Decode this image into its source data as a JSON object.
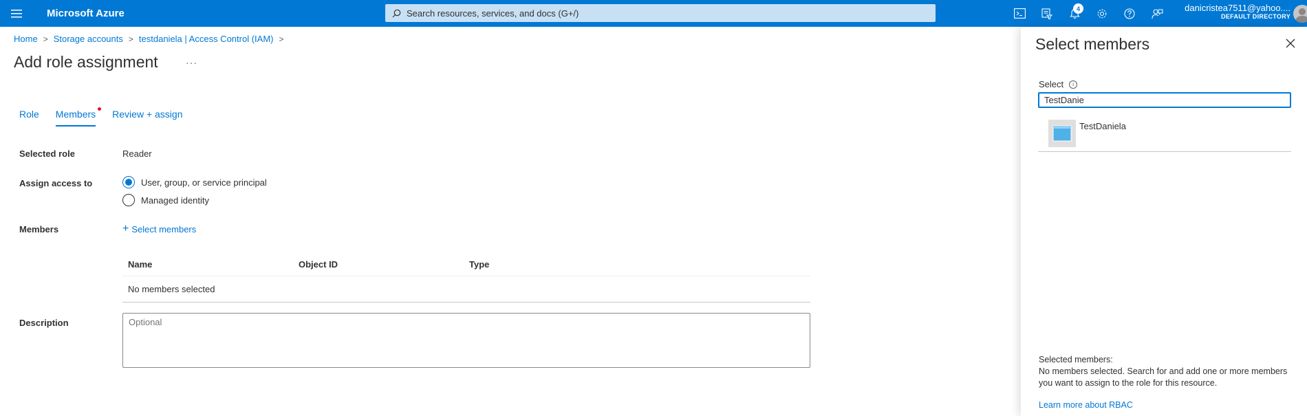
{
  "topbar": {
    "brand": "Microsoft Azure",
    "search_placeholder": "Search resources, services, and docs (G+/)",
    "notification_count": "4",
    "account_name": "danicristea7511@yahoo....",
    "account_directory": "DEFAULT DIRECTORY",
    "icons": [
      "cloud-shell-icon",
      "directory-filter-icon",
      "bell-icon",
      "gear-icon",
      "help-icon",
      "feedback-icon"
    ]
  },
  "breadcrumb": [
    "Home",
    "Storage accounts",
    "testdaniela | Access Control (IAM)"
  ],
  "page": {
    "title": "Add role assignment",
    "more": "···"
  },
  "tabs": [
    {
      "label": "Role",
      "active": false
    },
    {
      "label": "Members",
      "active": true,
      "required": true
    },
    {
      "label": "Review + assign",
      "active": false
    }
  ],
  "form": {
    "selected_role_label": "Selected role",
    "selected_role_value": "Reader",
    "assign_access_label": "Assign access to",
    "assign_options": [
      {
        "label": "User, group, or service principal",
        "selected": true
      },
      {
        "label": "Managed identity",
        "selected": false
      }
    ],
    "members_label": "Members",
    "select_members_link": "Select members",
    "table_headers": [
      "Name",
      "Object ID",
      "Type"
    ],
    "table_empty": "No members selected",
    "description_label": "Description",
    "description_placeholder": "Optional"
  },
  "panel": {
    "title": "Select members",
    "select_label": "Select",
    "search_value": "TestDanie",
    "results": [
      {
        "name": "TestDaniela"
      }
    ],
    "selected_members_label": "Selected members:",
    "selected_members_message": "No members selected. Search for and add one or more members you want to assign to the role for this resource.",
    "learn_more": "Learn more about RBAC"
  },
  "colors": {
    "accent": "#0078d4",
    "search_bg": "#c7e0f4",
    "required": "#e81123"
  }
}
